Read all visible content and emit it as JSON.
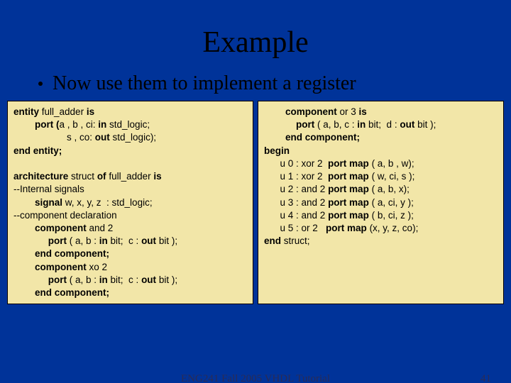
{
  "title": "Example",
  "bullet": "Now use them to implement a register",
  "left": {
    "l1a": "entity",
    "l1b": " full_adder ",
    "l1c": "is",
    "l2a": "        port (",
    "l2b": "a , b , ci: ",
    "l2c": "in",
    "l2d": " std_logic;",
    "l3a": "                    s , co: ",
    "l3b": "out",
    "l3c": " std_logic);",
    "l4": "end entity;",
    "l5": "",
    "l6a": "architecture",
    "l6b": " struct ",
    "l6c": "of",
    "l6d": " full_adder ",
    "l6e": "is",
    "l7": "--Internal signals",
    "l8a": "        signal",
    "l8b": " w, x, y, z  : std_logic;",
    "l9": "--component declaration",
    "l10a": "        component",
    "l10b": " and 2",
    "l11a": "             port",
    "l11b": " ( a, b : ",
    "l11c": "in",
    "l11d": " bit;  c : ",
    "l11e": "out",
    "l11f": " bit );",
    "l12": "        end component;",
    "l13a": "        component",
    "l13b": " xo 2",
    "l14a": "             port",
    "l14b": " ( a, b : ",
    "l14c": "in",
    "l14d": " bit;  c : ",
    "l14e": "out",
    "l14f": " bit );",
    "l15": "        end component;"
  },
  "right": {
    "r1a": "        component",
    "r1b": " or 3 ",
    "r1c": "is",
    "r2a": "            port",
    "r2b": " ( a, b, c : ",
    "r2c": "in",
    "r2d": " bit;  d : ",
    "r2e": "out",
    "r2f": " bit );",
    "r3": "        end component;",
    "r4": "begin",
    "r5a": "      u 0 : xor 2  ",
    "r5b": "port map",
    "r5c": " ( a, b , w);",
    "r6a": "      u 1 : xor 2  ",
    "r6b": "port map",
    "r6c": " ( w, ci, s );",
    "r7a": "      u 2 : and 2 ",
    "r7b": "port map",
    "r7c": " ( a, b, x);",
    "r8a": "      u 3 : and 2 ",
    "r8b": "port map",
    "r8c": " ( a, ci, y );",
    "r9a": "      u 4 : and 2 ",
    "r9b": "port map",
    "r9c": " ( b, ci, z );",
    "r10a": "      u 5 : or 2   ",
    "r10b": "port map",
    "r10c": " (x, y, z, co);",
    "r11a": "end",
    "r11b": " struct;"
  },
  "footer": {
    "center": "ENG241 Fall 2005 VHDL Tutorial",
    "page": "41"
  }
}
